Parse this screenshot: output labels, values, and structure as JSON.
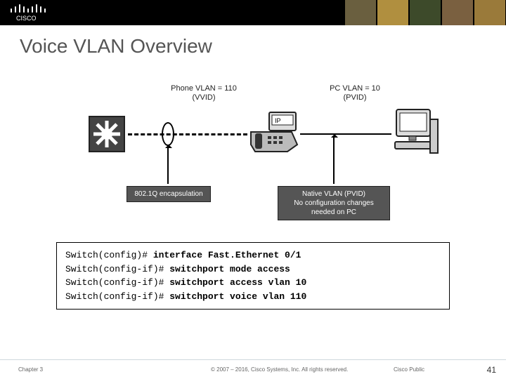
{
  "header": {
    "brand": "cisco"
  },
  "title": "Voice VLAN Overview",
  "diagram": {
    "phone_vlan_label": "Phone VLAN = 110",
    "phone_vlan_sub": "(VVID)",
    "pc_vlan_label": "PC VLAN = 10",
    "pc_vlan_sub": "(PVID)",
    "callout_encap": "802.1Q encapsulation",
    "callout_native_line1": "Native VLAN (PVID)",
    "callout_native_line2": "No configuration changes",
    "callout_native_line3": "needed on PC",
    "ip_label": "IP"
  },
  "cli": {
    "lines": [
      {
        "prompt": "Switch(config)# ",
        "cmd": "interface Fast.Ethernet 0/1"
      },
      {
        "prompt": "Switch(config-if)# ",
        "cmd": "switchport mode access"
      },
      {
        "prompt": "Switch(config-if)# ",
        "cmd": "switchport access vlan 10"
      },
      {
        "prompt": "Switch(config-if)# ",
        "cmd": "switchport voice vlan 110"
      }
    ]
  },
  "footer": {
    "chapter": "Chapter 3",
    "copyright": "© 2007 – 2016, Cisco Systems, Inc. All rights reserved.",
    "pub": "Cisco Public",
    "page": "41"
  }
}
